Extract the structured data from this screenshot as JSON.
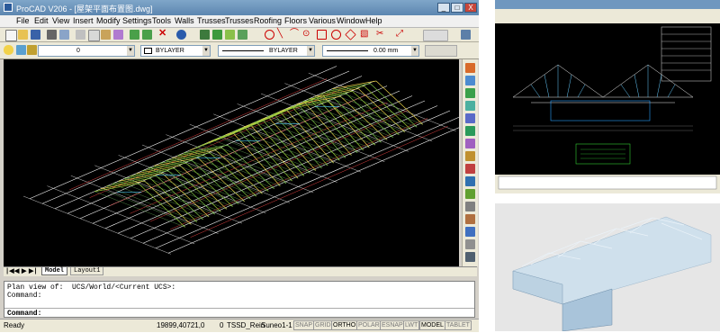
{
  "window": {
    "title": "ProCAD V206 - [屋架平面布置图.dwg]",
    "controls": [
      "_",
      "□",
      "X"
    ]
  },
  "menu": [
    "File",
    "Edit",
    "View",
    "Insert",
    "Modify",
    "Settings",
    "Tools",
    "Walls",
    "Trusses",
    "Trusses",
    "Roofing",
    "Floors",
    "Various",
    "Window",
    "Help"
  ],
  "properties_bar": {
    "layer": "0",
    "color": "BYLAYER",
    "linetype": "BYLAYER",
    "lineweight": "0.00 mm"
  },
  "tabs": [
    "Model",
    "Layout1"
  ],
  "command_lines": [
    "Plan view of:  UCS/World/<Current UCS>:",
    "Command:"
  ],
  "command_prompt": "Command:",
  "status": {
    "ready": "Ready",
    "coords": "19899,40721,0",
    "layer_num": "0",
    "style": "TSSD_Rein",
    "ucs": "Suneo1-1",
    "buttons": [
      "SNAP",
      "GRID",
      "ORTHO",
      "POLAR",
      "ESNAP",
      "LWT",
      "MODEL",
      "TABLET"
    ],
    "active": [
      "ORTHO",
      "MODEL"
    ]
  },
  "colors": {
    "titlebar": "#6f97bf",
    "cad_background": "#000000",
    "truss_green": "#9acd32",
    "grid_white": "#ffffff",
    "grid_red": "#e04040"
  }
}
